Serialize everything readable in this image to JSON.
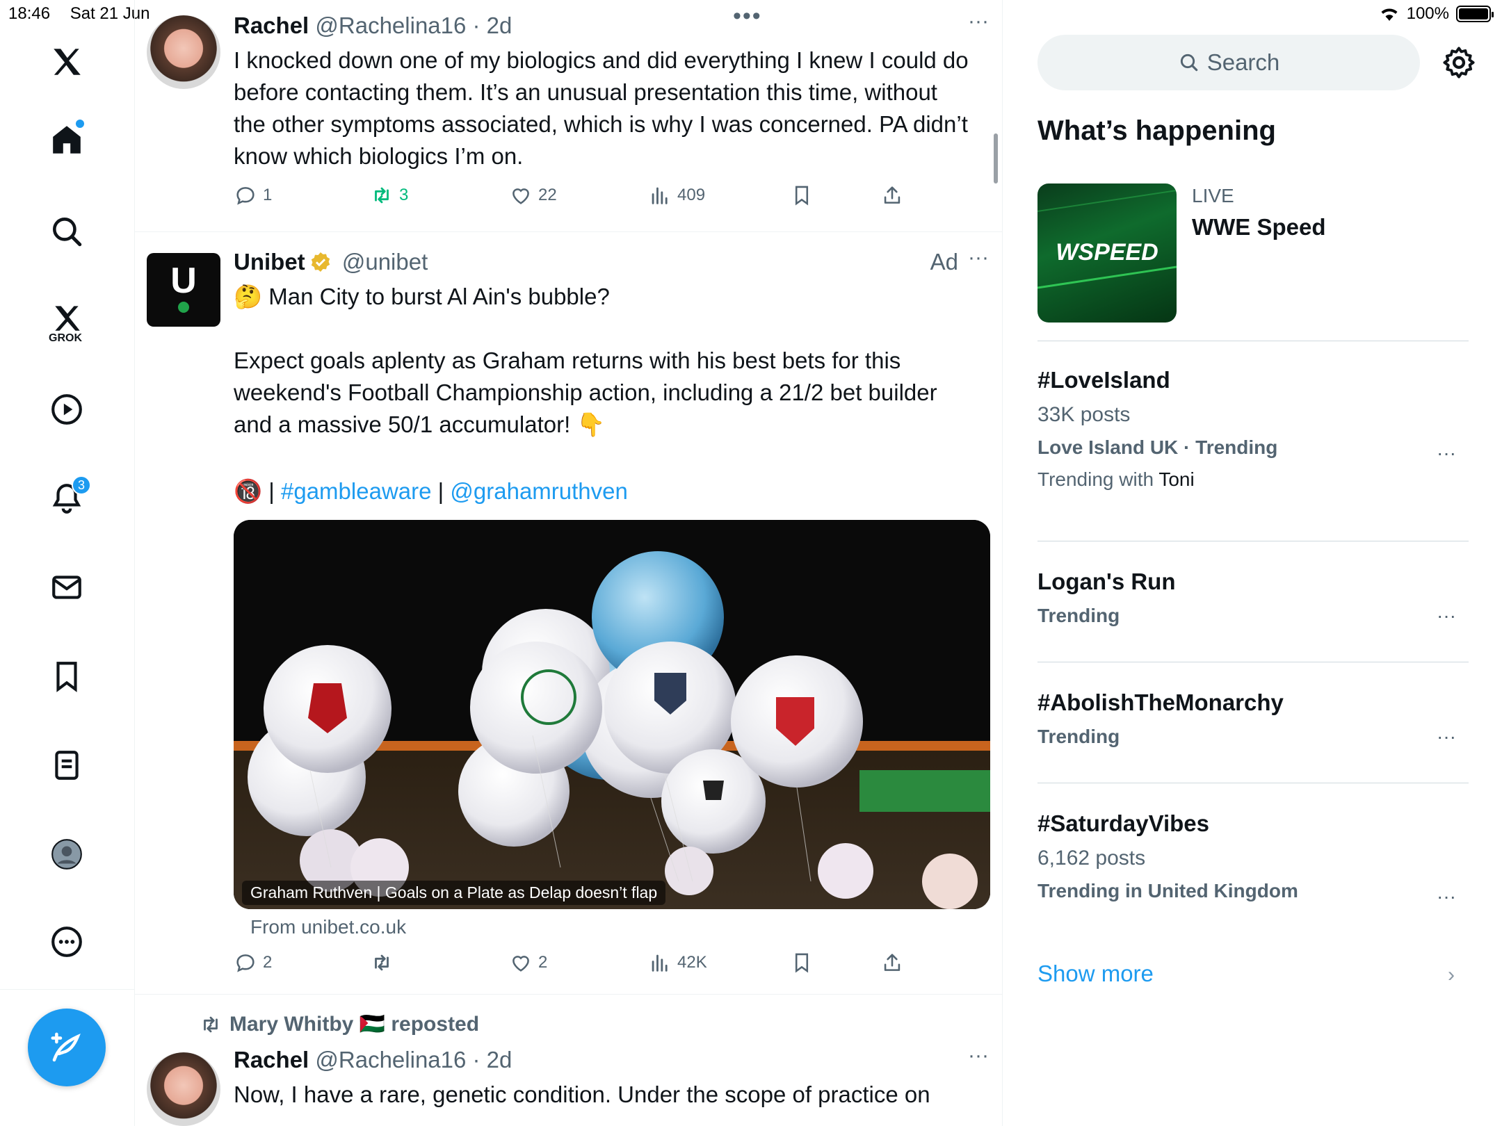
{
  "status_bar": {
    "time": "18:46",
    "date": "Sat 21 Jun",
    "battery": "100%"
  },
  "nav": {
    "grok_label": "GROK",
    "notifications_badge": "3"
  },
  "feed": {
    "posts": [
      {
        "name": "Rachel",
        "handle": "@Rachelina16 · 2d",
        "text": "I knocked down one of my biologics and did everything I knew I could do before contacting them. It’s an unusual presentation this time, without the other symptoms associated, which is why I was concerned. PA didn’t know which biologics I’m on.",
        "replies": "1",
        "reposts": "3",
        "likes": "22",
        "views": "409"
      },
      {
        "name": "Unibet",
        "handle": "@unibet",
        "ad_label": "Ad",
        "line1": "🤔 Man City to burst Al Ain's bubble?",
        "line2": "Expect goals aplenty as Graham returns with his best bets for this weekend's Football Championship action, including a 21/2 bet builder and a massive 50/1 accumulator! 👇",
        "line3_prefix": "🔞 | ",
        "hashtag": "#gambleaware",
        "sep": " | ",
        "mention": "@grahamruthven",
        "media_caption": "Graham Ruthven | Goals on a Plate as Delap doesn’t flap",
        "source": "From unibet.co.uk",
        "replies": "2",
        "likes": "2",
        "views": "42K"
      },
      {
        "reposted_by": "Mary Whitby 🇵🇸 reposted",
        "name": "Rachel",
        "handle": "@Rachelina16 · 2d",
        "text": "Now, I have a rare, genetic condition. Under the scope of practice on"
      }
    ]
  },
  "right": {
    "search_placeholder": "Search",
    "section_title": "What’s happening",
    "live": {
      "label": "LIVE",
      "title": "WWE Speed"
    },
    "trends": [
      {
        "title": "#LoveIsland",
        "posts": "33K posts",
        "meta": "Love Island UK · Trending",
        "extra_prefix": "Trending with ",
        "extra_name": "Toni"
      },
      {
        "title": "Logan's Run",
        "meta": "Trending"
      },
      {
        "title": "#AbolishTheMonarchy",
        "meta": "Trending"
      },
      {
        "title": "#SaturdayVibes",
        "posts": "6,162 posts",
        "meta": "Trending in United Kingdom"
      }
    ],
    "show_more": "Show more"
  },
  "colors": {
    "accent": "#1d9bf0",
    "repost_green": "#00ba7c",
    "muted": "#536471"
  }
}
